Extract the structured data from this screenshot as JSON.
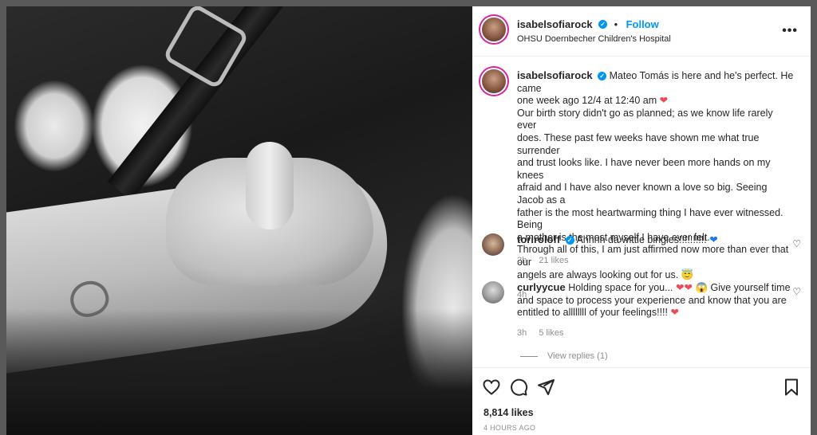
{
  "post": {
    "username": "isabelsofiarock",
    "follow_label": "Follow",
    "separator": "•",
    "location": "OHSU Doernbecher Children's Hospital",
    "more_label": "•••"
  },
  "caption": {
    "username": "isabelsofiarock",
    "lines": [
      "Mateo Tomás is here and he's perfect. He came",
      "one week ago 12/4 at 12:40 am",
      "Our birth story didn't go as planned; as we know life rarely ever",
      "does. These past few weeks have shown me what true surrender",
      "and trust looks like. I have never been more hands on my knees",
      "afraid and I have also never known a love so big. Seeing Jacob as a",
      "father is the most heartwarming thing I have ever witnessed. Being",
      "a mother is the most myself I have ever felt.",
      "Through all of this, I am just affirmed now more than ever that our",
      "angels are always looking out for us."
    ],
    "time": "4h"
  },
  "comments": [
    {
      "username": "toriroloff",
      "text": "Ahhhh da wittle bingies!!!!!!!!!!",
      "time": "2h",
      "likes": "21 likes"
    },
    {
      "username": "curlyycue",
      "text_1": "Holding space for you...",
      "text_2": "Give yourself time",
      "text_3": "and space to process your experience and know that you are",
      "text_4": "entitled to allllllll of your feelings!!!!",
      "time": "3h",
      "likes": "5 likes",
      "view_replies": "View replies (1)"
    }
  ],
  "stats": {
    "likes": "8,814 likes",
    "time_ago": "4 HOURS AGO"
  },
  "colors": {
    "accent": "#0095f6",
    "heart": "#ed4956",
    "blue_heart": "#1877f2"
  }
}
